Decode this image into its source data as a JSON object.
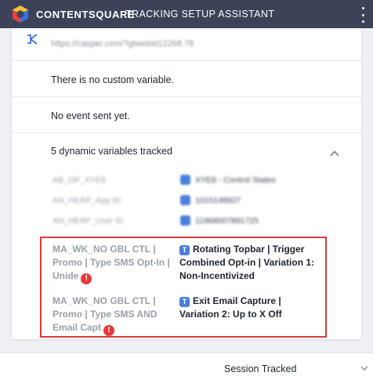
{
  "header": {
    "brand": "CONTENTSQUARE",
    "title": "TRACKING SETUP ASSISTANT"
  },
  "page": {
    "url": "https://casper.com/?gtwebst12268.78",
    "custom_variables_status": "There is no custom variable.",
    "events_status": "No event sent yet.",
    "dynamic_variables_heading": "5 dynamic variables tracked",
    "blurred_variables": [
      {
        "name": "AB_OP_XYE8",
        "badge": "T",
        "value": "XYE8 - Control States"
      },
      {
        "name": "AN_HEAP_App ID",
        "badge": "T",
        "value": "1015148827"
      },
      {
        "name": "AN_HEAP_User ID",
        "badge": "T",
        "value": "11968007891725"
      }
    ],
    "highlighted_variables": [
      {
        "name": "MA_WK_NO GBL CTL | Promo | Type SMS Opt-In | Unide",
        "badge": "T",
        "value": "Rotating Topbar | Trigger Combined Opt-in | Variation 1: Non-Incentivized"
      },
      {
        "name": "MA_WK_NO GBL CTL | Promo | Type SMS AND Email Capt",
        "badge": "T",
        "value": "Exit Email Capture | Variation 2: Up to X Off"
      }
    ],
    "warning_glyph": "!"
  },
  "footer": {
    "session_select_value": "Session Tracked"
  },
  "colors": {
    "topbar": "#3c4358",
    "accent_blue": "#4a7fdc",
    "warning_red": "#e23b3b",
    "highlight_border": "#d63a3a"
  }
}
